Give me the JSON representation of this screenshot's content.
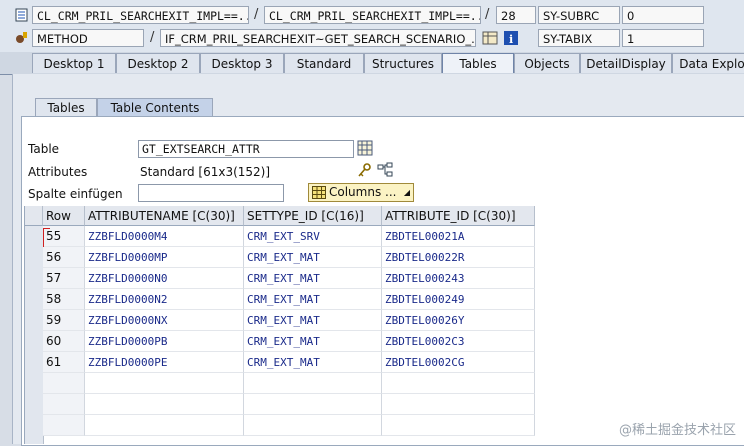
{
  "header": {
    "row1": {
      "class_name": "CL_CRM_PRIL_SEARCHEXIT_IMPL==...",
      "class_name2": "CL_CRM_PRIL_SEARCHEXIT_IMPL==...",
      "line": "28",
      "var_name": "SY-SUBRC",
      "var_value": "0"
    },
    "row2": {
      "type": "METHOD",
      "method": "IF_CRM_PRIL_SEARCHEXIT~GET_SEARCH_SCENARIO_...",
      "var_name": "SY-TABIX",
      "var_value": "1"
    },
    "sep": "/"
  },
  "tabs": [
    "Desktop 1",
    "Desktop 2",
    "Desktop 3",
    "Standard",
    "Structures",
    "Tables",
    "Objects",
    "DetailDisplay",
    "Data Explo"
  ],
  "subtabs": [
    "Tables",
    "Table Contents"
  ],
  "form": {
    "table_label": "Table",
    "table_value": "GT_EXTSEARCH_ATTR",
    "attributes_label": "Attributes",
    "attributes_value": "Standard [61x3(152)]",
    "spalte_label": "Spalte einfügen",
    "columns_button": "Columns ..."
  },
  "grid": {
    "headers": [
      "Row",
      "ATTRIBUTENAME [C(30)]",
      "SETTYPE_ID [C(16)]",
      "ATTRIBUTE_ID [C(30)]"
    ],
    "rows": [
      [
        "55",
        "ZZBFLD0000M4",
        "CRM_EXT_SRV",
        "ZBDTEL00021A"
      ],
      [
        "56",
        "ZZBFLD0000MP",
        "CRM_EXT_MAT",
        "ZBDTEL00022R"
      ],
      [
        "57",
        "ZZBFLD0000N0",
        "CRM_EXT_MAT",
        "ZBDTEL000243"
      ],
      [
        "58",
        "ZZBFLD0000N2",
        "CRM_EXT_MAT",
        "ZBDTEL000249"
      ],
      [
        "59",
        "ZZBFLD0000NX",
        "CRM_EXT_MAT",
        "ZBDTEL00026Y"
      ],
      [
        "60",
        "ZZBFLD0000PB",
        "CRM_EXT_MAT",
        "ZBDTEL0002C3"
      ],
      [
        "61",
        "ZZBFLD0000PE",
        "CRM_EXT_MAT",
        "ZBDTEL0002CG"
      ]
    ]
  },
  "watermark": "@稀土掘金技术社区",
  "icons": [
    "class-icon",
    "method-icon",
    "table-icon",
    "info-icon",
    "table-picker-icon",
    "key-icon",
    "structure-icon"
  ]
}
